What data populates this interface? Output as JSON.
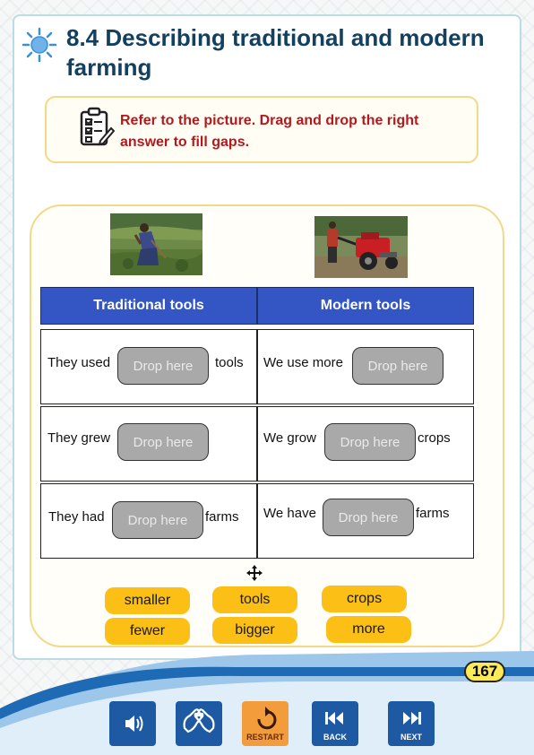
{
  "title": "8.4 Describing traditional and modern farming",
  "instruction": "Refer to the picture. Drag and drop the right answer to fill gaps.",
  "table": {
    "headers": [
      "Traditional tools",
      "Modern tools"
    ],
    "rows": [
      {
        "left": {
          "before": "They used",
          "drop": "Drop here",
          "after": "tools"
        },
        "right": {
          "before": "We use more",
          "drop": "Drop here",
          "after": ""
        }
      },
      {
        "left": {
          "before": "They grew",
          "drop": "Drop here",
          "after": ""
        },
        "right": {
          "before": "We grow",
          "drop": "Drop here",
          "after": "crops"
        }
      },
      {
        "left": {
          "before": "They had",
          "drop": "Drop here",
          "after": "farms"
        },
        "right": {
          "before": "We have",
          "drop": "Drop here",
          "after": "farms"
        }
      }
    ]
  },
  "answer_chips": [
    "smaller",
    "tools",
    "crops",
    "fewer",
    "bigger",
    "more"
  ],
  "page_number": "167",
  "nav": {
    "restart_label": "RESTART",
    "back_label": "BACK",
    "next_label": "NEXT"
  },
  "colors": {
    "title": "#14405f",
    "instruction": "#b3191d",
    "table_header": "#3456c4",
    "chip": "#fbbf16",
    "drop_zone": "#a9a9a9",
    "nav_button": "#1e5aa4",
    "restart_button": "#f29c3c",
    "page_badge": "#fcea56"
  },
  "icons": [
    "sun-icon",
    "checklist-icon",
    "move-icon",
    "audio-icon",
    "sign-language-icon",
    "restart-icon",
    "back-icon",
    "next-icon"
  ]
}
